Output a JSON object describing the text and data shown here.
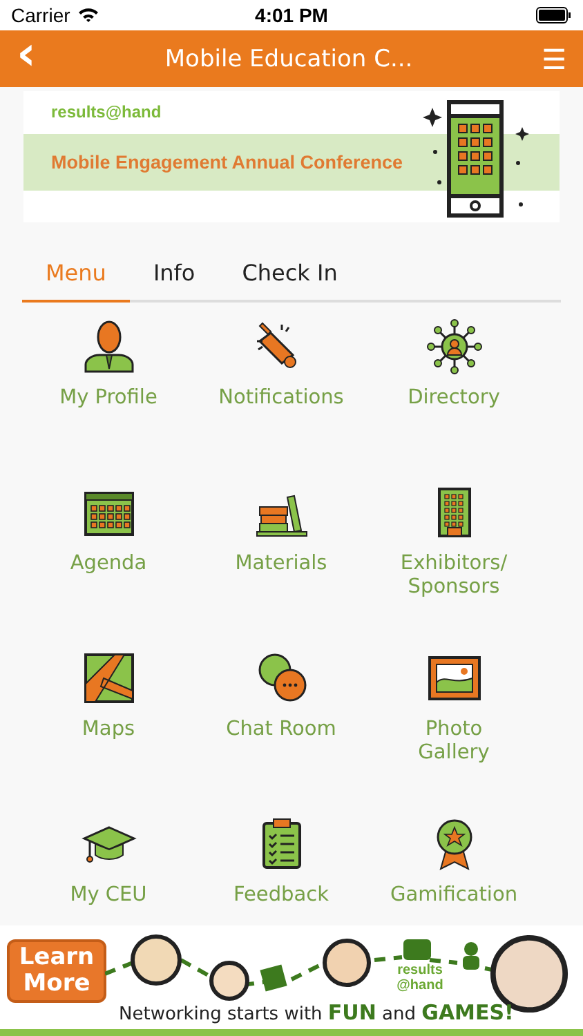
{
  "status_bar": {
    "carrier": "Carrier",
    "time": "4:01 PM"
  },
  "nav_bar": {
    "back": "‹",
    "title": "Mobile Education C...",
    "menu": "☰"
  },
  "banner": {
    "logo": "results@hand",
    "headline": "Mobile Engagement Annual Conference"
  },
  "tabs": [
    {
      "label": "Menu",
      "selected": true
    },
    {
      "label": "Info",
      "selected": false
    },
    {
      "label": "Check In",
      "selected": false
    }
  ],
  "menu_items": [
    {
      "label": "My Profile"
    },
    {
      "label": "Notifications"
    },
    {
      "label": "Directory"
    },
    {
      "label": "Agenda"
    },
    {
      "label": "Materials"
    },
    {
      "label": "Exhibitors/ Sponsors"
    },
    {
      "label": "Maps"
    },
    {
      "label": "Chat Room"
    },
    {
      "label": "Photo Gallery"
    },
    {
      "label": "My CEU"
    },
    {
      "label": "Feedback"
    },
    {
      "label": "Gamification"
    }
  ],
  "ad_banner": {
    "button": "Learn More",
    "logo": "results @hand",
    "tagline": "Networking starts with **FUN** and **GAMES!**"
  }
}
